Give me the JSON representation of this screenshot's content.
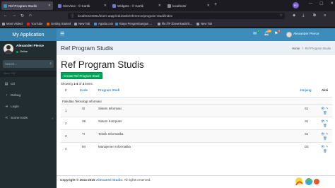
{
  "browser": {
    "tabs": [
      {
        "label": "Ref Program Studis",
        "active": true
      },
      {
        "label": "SiteView - © Kartik",
        "active": false
      },
      {
        "label": "Widgets - © Kartik",
        "active": false
      },
      {
        "label": "localhost/",
        "active": false
      }
    ],
    "new_tab": "+",
    "url": "localhost:8081/learn-aapp/edu/web/reference/program-studi/index",
    "ext_badge": "EG",
    "window_controls": [
      "—",
      "▢",
      "✕"
    ],
    "bookmarks": [
      {
        "label": "Most Visited",
        "color": "#9aa0a6"
      },
      {
        "label": "YouTube",
        "color": "#e62117"
      },
      {
        "label": "Getting Started",
        "color": "#e66000"
      },
      {
        "label": "New Tab",
        "color": "#9aa0a6"
      },
      {
        "label": "Agoda.com",
        "color": "#4a90d9"
      },
      {
        "label": "Biaya Pengembangan ...",
        "color": "#3c8dbc"
      },
      {
        "label": "file:///F:/Downloads/S...",
        "color": "#9aa0a6"
      },
      {
        "label": "New Tab",
        "color": "#9aa0a6"
      }
    ]
  },
  "header": {
    "brand": "My Application",
    "hamburger": "☰",
    "badges": [
      {
        "text": "4",
        "color": "#00a65a"
      },
      {
        "text": "10",
        "color": "#f39c12"
      },
      {
        "text": "9",
        "color": "#dd4b39"
      }
    ],
    "user_name": "Alexander Pierce"
  },
  "sidebar": {
    "user_name": "Alexander Pierce",
    "status": "Online",
    "search_placeholder": "Search...",
    "header": "Menu Yii2",
    "items": [
      {
        "label": "Gii",
        "icon": "file-code-icon"
      },
      {
        "label": "Debug",
        "icon": "dashboard-icon"
      },
      {
        "label": "Login",
        "icon": "login-icon"
      },
      {
        "label": "Some tools",
        "icon": "share-icon"
      }
    ]
  },
  "content": {
    "heading": "Ref Program Studis",
    "breadcrumb": [
      "Home",
      "Ref Program Studis"
    ],
    "title": "Ref Program Studis",
    "create_button": "Create Ref Program Studi",
    "summary_prefix": "Showing",
    "summary_range": "1-4",
    "summary_of": "of",
    "summary_count": "4",
    "summary_suffix": "items.",
    "columns": {
      "num": "#",
      "kode": "Kode",
      "program": "Program Studi",
      "jenjang": "Jenjang",
      "aksi": "Aksi"
    },
    "group": "Fakultas Teknologi Informasi",
    "rows": [
      {
        "num": "1",
        "kode": "SI",
        "program": "Sistem Informasi",
        "jenjang": "S1"
      },
      {
        "num": "2",
        "kode": "SK",
        "program": "Sistem Komputer",
        "jenjang": "S1"
      },
      {
        "num": "3",
        "kode": "TI",
        "program": "Teknik Informatika",
        "jenjang": "S1"
      },
      {
        "num": "4",
        "kode": "MI",
        "program": "Manajemen Informatika",
        "jenjang": "D3"
      }
    ]
  },
  "footer": {
    "prefix": "Copyright © 2014-2015",
    "studio": "Almsaeed Studio",
    "suffix": ". All rights reserved."
  }
}
